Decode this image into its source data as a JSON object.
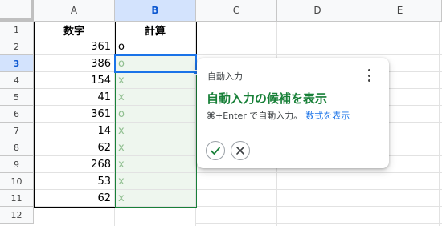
{
  "columns": [
    "A",
    "B",
    "C",
    "D",
    "E"
  ],
  "rows": [
    "1",
    "2",
    "3",
    "4",
    "5",
    "6",
    "7",
    "8",
    "9",
    "10",
    "11",
    "12"
  ],
  "sheet": {
    "header_a": "数字",
    "header_b": "計算",
    "values": [
      "361",
      "386",
      "154",
      "41",
      "361",
      "14",
      "62",
      "268",
      "53",
      "62"
    ],
    "entered_b2": "o",
    "suggestions_b": [
      "o",
      "x",
      "x",
      "o",
      "x",
      "x",
      "x",
      "x",
      "x"
    ]
  },
  "popup": {
    "title": "自動入力",
    "heading": "自動入力の候補を表示",
    "description": "⌘+Enter で自動入力。",
    "link": "数式を表示"
  },
  "colors": {
    "accent_blue": "#1a73e8",
    "suggestion_green": "#188038",
    "suggestion_bg": "#eef6ee"
  }
}
